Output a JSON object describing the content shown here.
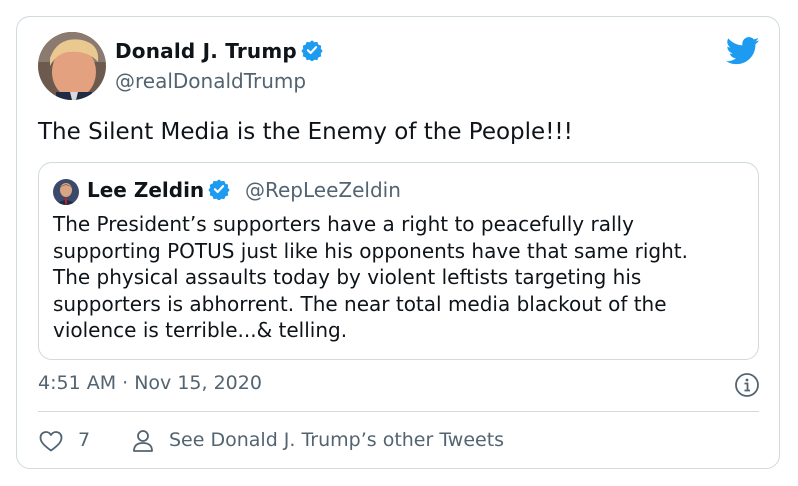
{
  "author": {
    "name": "Donald J. Trump",
    "handle": "@realDonaldTrump",
    "avatar": "portrait-avatar",
    "verified": true
  },
  "tweet": {
    "text": "The Silent Media is the Enemy of the People!!!",
    "timestamp": "4:51 AM · Nov 15, 2020"
  },
  "quoted": {
    "name": "Lee Zeldin",
    "handle": "@RepLeeZeldin",
    "verified": true,
    "lines": [
      "The President’s supporters have a right to peacefully rally",
      "supporting POTUS just like his opponents have that same right.",
      "The physical assaults today by violent leftists targeting his",
      "supporters is abhorrent. The near total media blackout of the",
      "violence is terrible...& telling."
    ]
  },
  "footer": {
    "likes": "7",
    "other_tweets": "See Donald J. Trump’s other Tweets"
  },
  "icons": {
    "brand": "twitter-bird-icon",
    "info": "info-icon",
    "like": "heart-icon",
    "profile": "person-icon"
  },
  "colors": {
    "brand": "#1d9bf0",
    "text": "#0f1419",
    "secondary": "#536471",
    "border": "#cfd9de"
  }
}
